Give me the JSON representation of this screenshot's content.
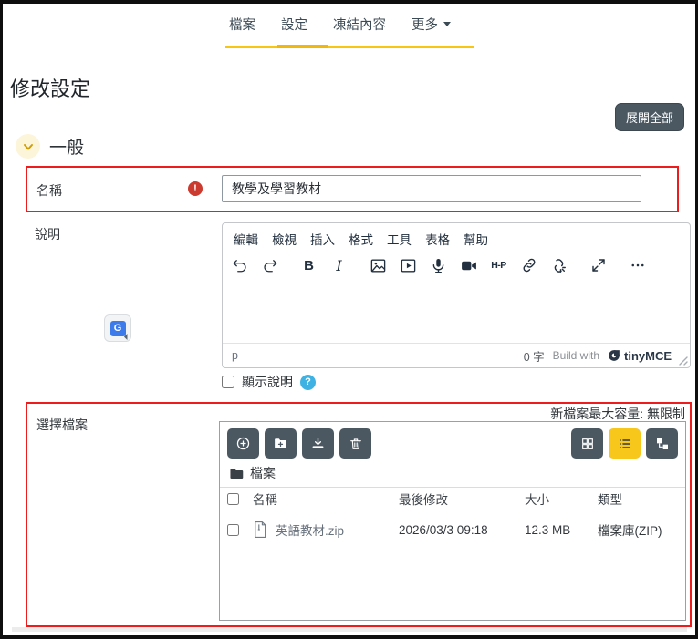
{
  "tabs": {
    "items": [
      {
        "label": "檔案"
      },
      {
        "label": "設定"
      },
      {
        "label": "凍結內容"
      },
      {
        "label": "更多"
      }
    ]
  },
  "page": {
    "title": "修改設定",
    "expand_all": "展開全部"
  },
  "general": {
    "section_title": "一般",
    "name": {
      "label": "名稱",
      "value": "教學及學習教材"
    },
    "description": {
      "label": "說明"
    },
    "show_description": "顯示說明"
  },
  "editor": {
    "menu": [
      "編輯",
      "檢視",
      "插入",
      "格式",
      "工具",
      "表格",
      "幫助"
    ],
    "bold_glyph": "B",
    "italic_glyph": "I",
    "h5p_label": "H-P",
    "element_path": "p",
    "word_count": "0 字",
    "build_with": "Build with",
    "brand": "tinyMCE"
  },
  "files": {
    "label": "選擇檔案",
    "max_size": "新檔案最大容量: 無限制",
    "breadcrumb": "檔案",
    "headers": {
      "name": "名稱",
      "modified": "最後修改",
      "size": "大小",
      "type": "類型"
    },
    "rows": [
      {
        "name": "英語教材.zip",
        "modified": "2026/03/3 09:18",
        "size": "12.3 MB",
        "type": "檔案庫(ZIP)"
      }
    ]
  },
  "icons": {
    "required_glyph": "!",
    "help_glyph": "?",
    "translate_glyph": "G"
  },
  "colors": {
    "accent_yellow": "#f8c41a",
    "button_slate": "#4b5862",
    "highlight_red": "#ee1d1d",
    "required_red": "#cb3b2f",
    "help_blue": "#3fb2e3"
  }
}
